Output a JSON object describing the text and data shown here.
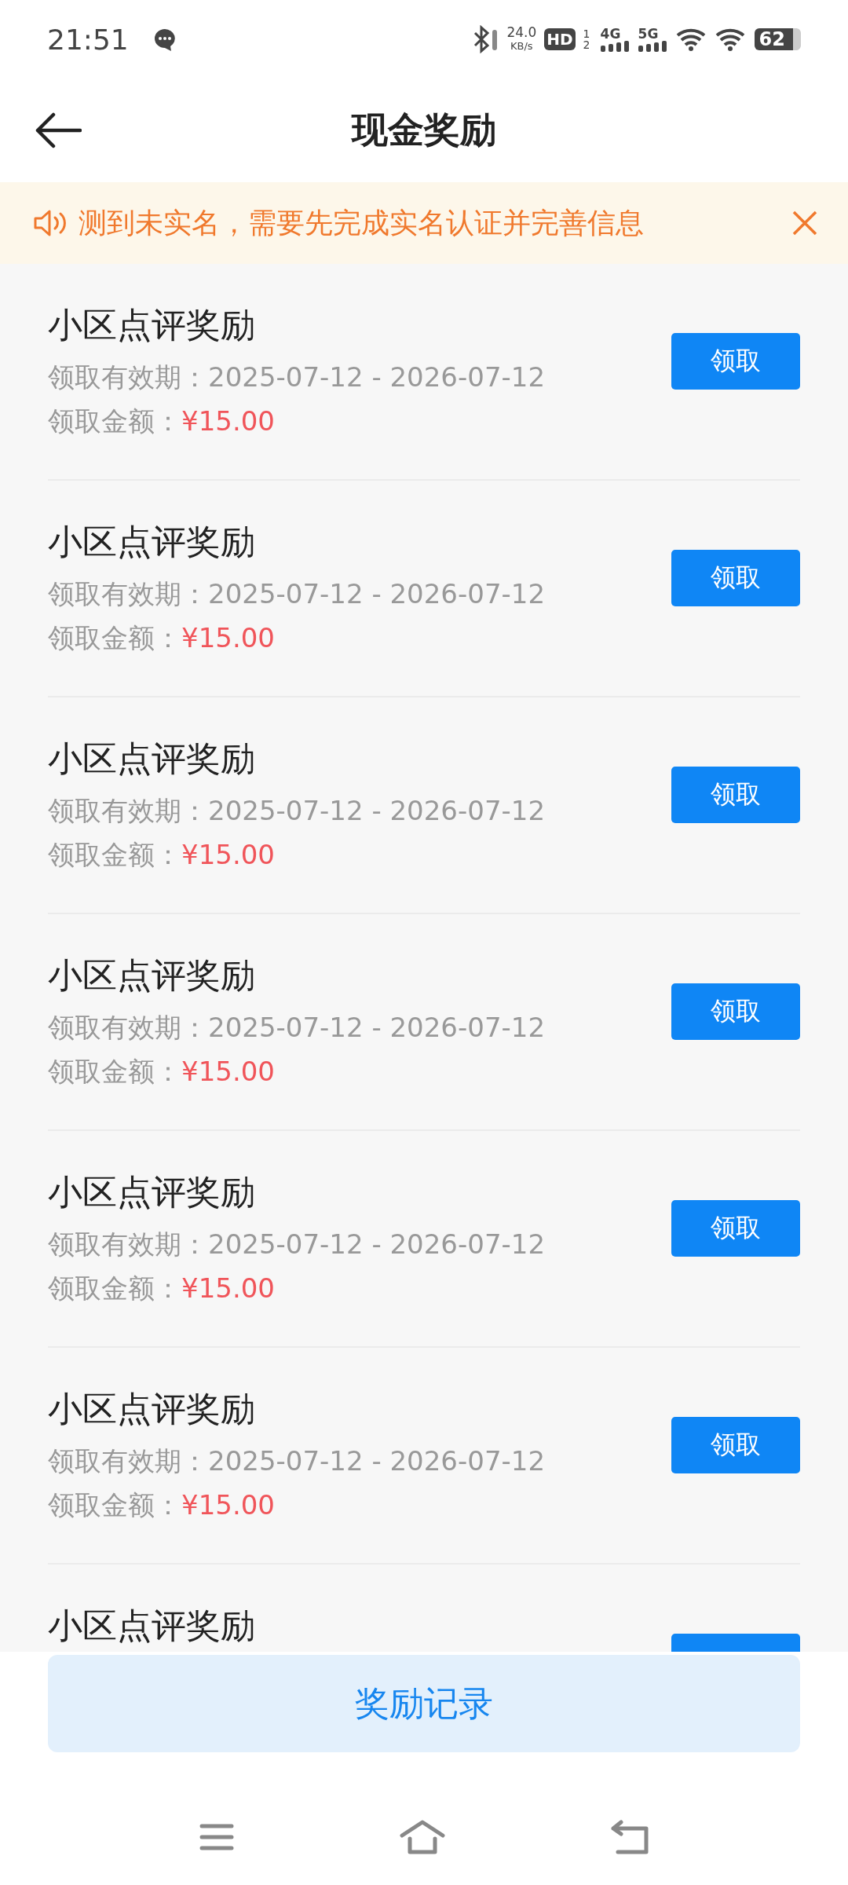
{
  "status_bar": {
    "time": "21:51",
    "speed": "24.0",
    "speed_unit": "KB/s",
    "hd": "HD",
    "hd_sims": "1 2",
    "net1": "4G",
    "net2": "5G",
    "battery": "62"
  },
  "header": {
    "title": "现金奖励"
  },
  "notice": {
    "text": "测到未实名，需要先完成实名认证并完善信息"
  },
  "rewards": [
    {
      "title": "小区点评奖励",
      "validity_label": "领取有效期：",
      "validity": "2025-07-12 - 2026-07-12",
      "amount_label": "领取金额：",
      "amount": "¥15.00",
      "button": "领取"
    },
    {
      "title": "小区点评奖励",
      "validity_label": "领取有效期：",
      "validity": "2025-07-12 - 2026-07-12",
      "amount_label": "领取金额：",
      "amount": "¥15.00",
      "button": "领取"
    },
    {
      "title": "小区点评奖励",
      "validity_label": "领取有效期：",
      "validity": "2025-07-12 - 2026-07-12",
      "amount_label": "领取金额：",
      "amount": "¥15.00",
      "button": "领取"
    },
    {
      "title": "小区点评奖励",
      "validity_label": "领取有效期：",
      "validity": "2025-07-12 - 2026-07-12",
      "amount_label": "领取金额：",
      "amount": "¥15.00",
      "button": "领取"
    },
    {
      "title": "小区点评奖励",
      "validity_label": "领取有效期：",
      "validity": "2025-07-12 - 2026-07-12",
      "amount_label": "领取金额：",
      "amount": "¥15.00",
      "button": "领取"
    },
    {
      "title": "小区点评奖励",
      "validity_label": "领取有效期：",
      "validity": "2025-07-12 - 2026-07-12",
      "amount_label": "领取金额：",
      "amount": "¥15.00",
      "button": "领取"
    },
    {
      "title": "小区点评奖励"
    }
  ],
  "footer_button": {
    "label": "奖励记录"
  }
}
